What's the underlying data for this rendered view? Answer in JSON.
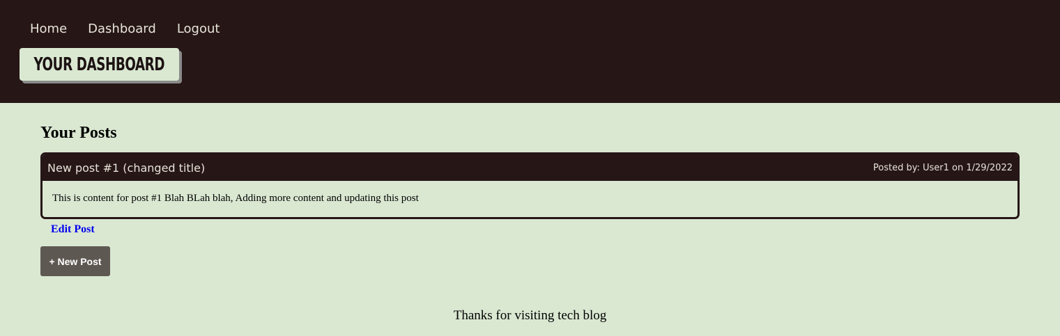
{
  "nav": {
    "items": [
      {
        "label": "Home"
      },
      {
        "label": "Dashboard"
      },
      {
        "label": "Logout"
      }
    ]
  },
  "header": {
    "title": "YOUR DASHBOARD"
  },
  "main": {
    "section_title": "Your Posts",
    "posts": [
      {
        "title": "New post #1 (changed title)",
        "meta": "Posted by: User1 on 1/29/2022",
        "content": "This is content for post #1 Blah BLah blah, Adding more content and updating this post",
        "edit_label": "Edit Post"
      }
    ],
    "new_post_label": "+ New Post"
  },
  "footer": {
    "text": "Thanks for visiting tech blog"
  },
  "colors": {
    "header_bg": "#261616",
    "page_bg": "#dae8d2",
    "button_bg": "#5e5852",
    "link": "#0000ee"
  }
}
